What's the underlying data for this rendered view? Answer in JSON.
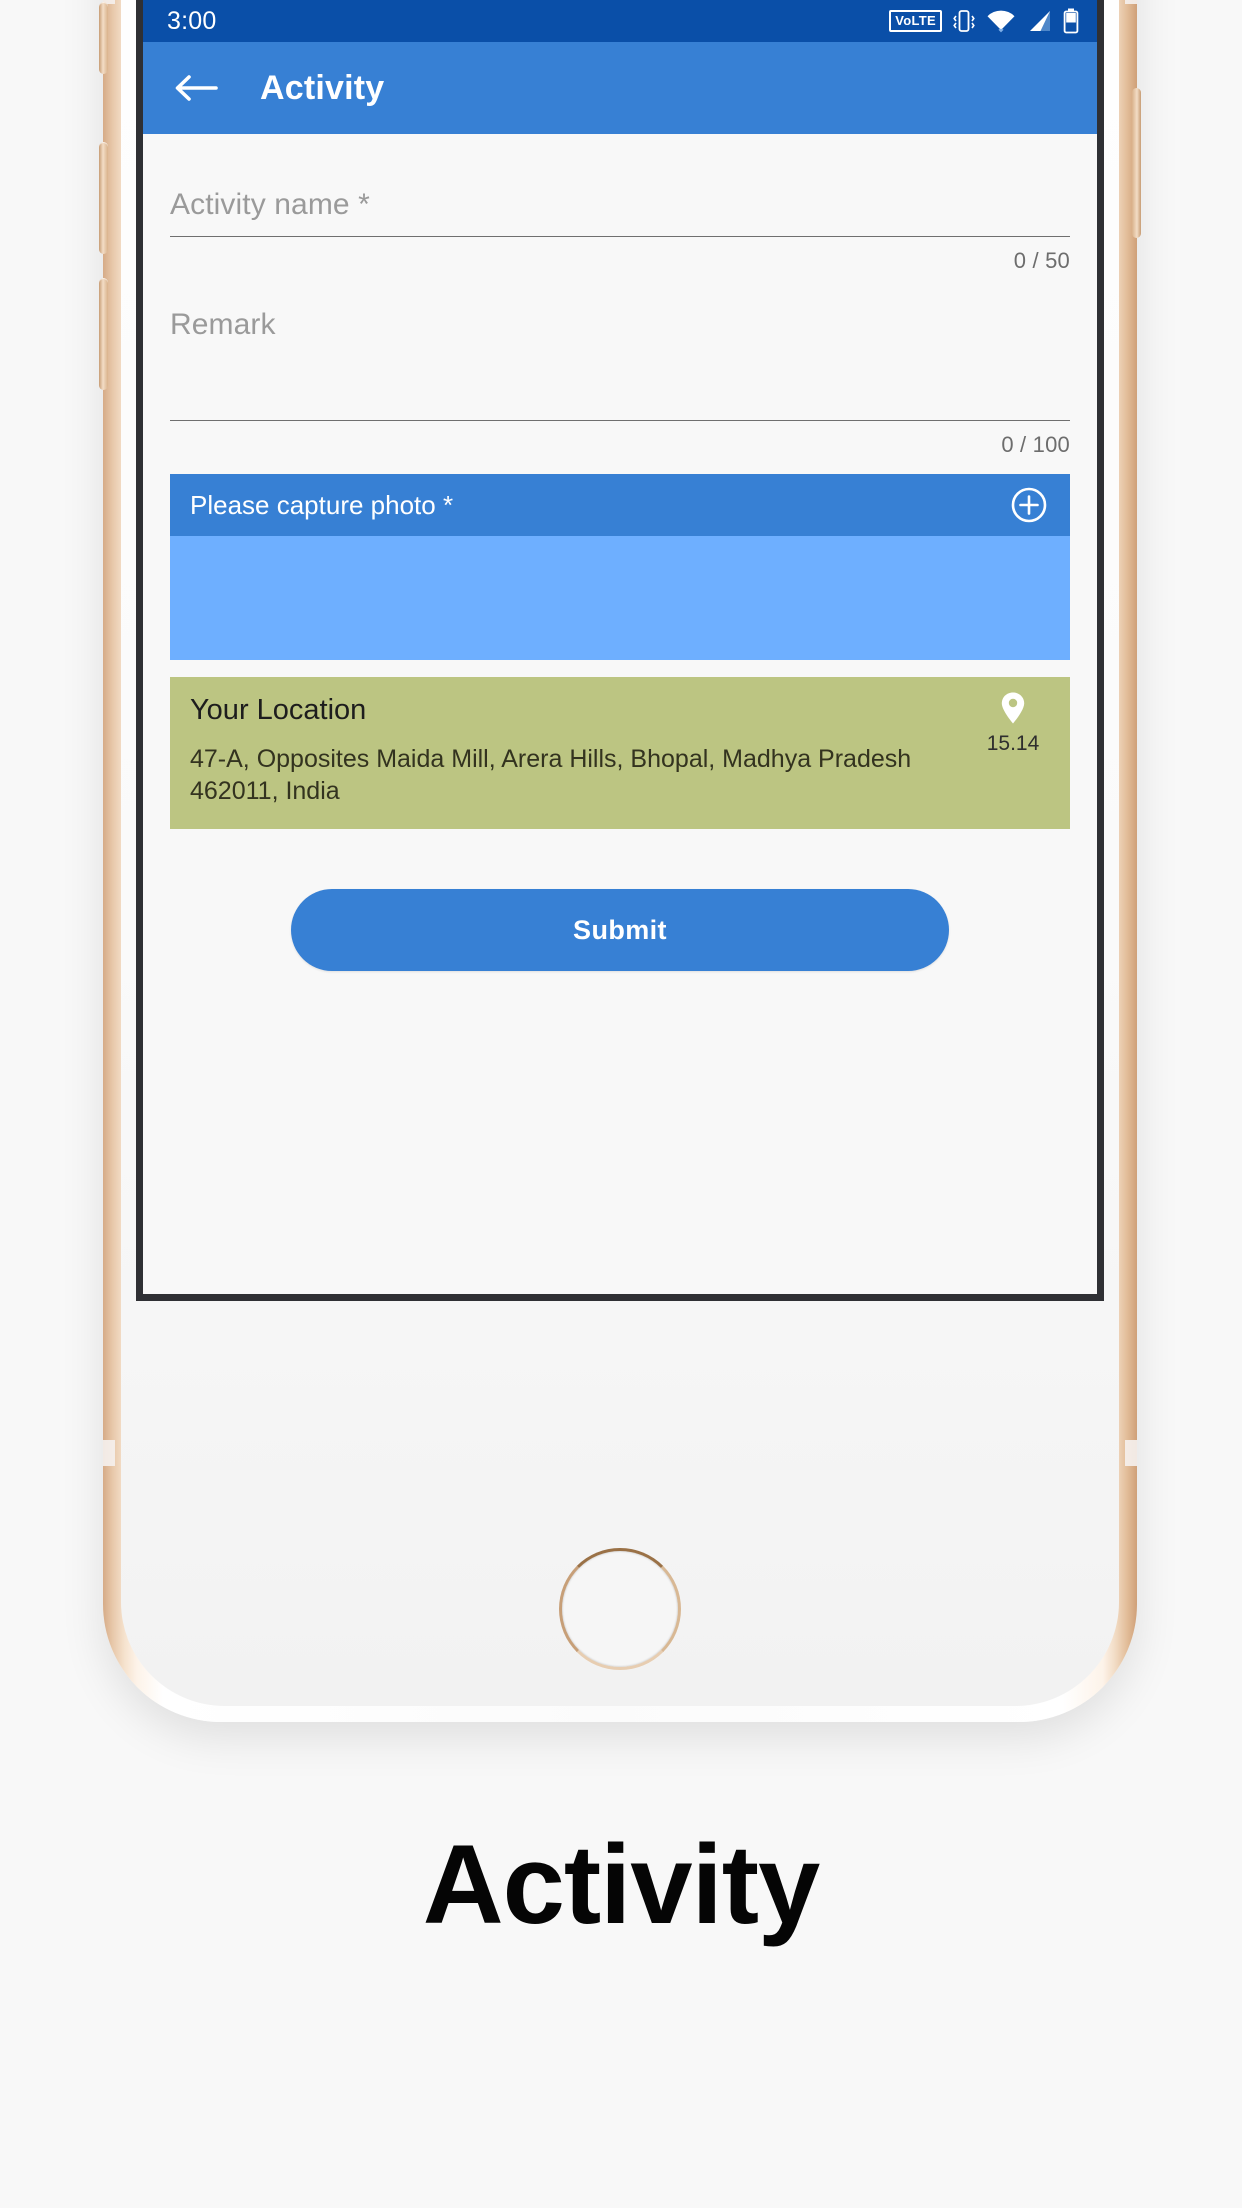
{
  "caption": "Activity",
  "statusbar": {
    "time": "3:00",
    "icons": [
      {
        "name": "volte-icon",
        "label": "VoLTE"
      },
      {
        "name": "vibrate-icon",
        "label": "vibrate"
      },
      {
        "name": "wifi-icon",
        "label": "wifi"
      },
      {
        "name": "cellular-signal-icon",
        "label": "signal"
      },
      {
        "name": "battery-icon",
        "label": "battery"
      }
    ],
    "background": "#0a4fa8"
  },
  "appbar": {
    "back_icon": "back-arrow-icon",
    "title": "Activity",
    "background": "#3780d4"
  },
  "form": {
    "activity_name": {
      "placeholder": "Activity name *",
      "value": "",
      "counter": "0 / 50"
    },
    "remark": {
      "placeholder": "Remark",
      "value": "",
      "counter": "0 / 100"
    }
  },
  "photo_section": {
    "label": "Please capture photo *",
    "add_icon": "plus-circle-icon",
    "header_background": "#3780d4",
    "area_background": "#6eafff"
  },
  "location_section": {
    "title": "Your Location",
    "pin_icon": "map-pin-icon",
    "accuracy": "15.14",
    "address": "47-A, Opposites Maida Mill, Arera Hills, Bhopal, Madhya Pradesh 462011, India",
    "background": "#bcc582"
  },
  "actions": {
    "submit_label": "Submit",
    "submit_color": "#3780d4"
  }
}
